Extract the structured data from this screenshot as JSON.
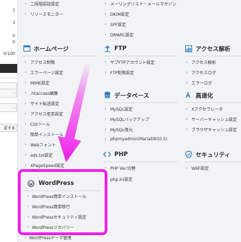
{
  "left_column": {
    "nums": [
      "1",
      "3",
      "0",
      "0",
      "0/100"
    ],
    "boxes": [
      "",
      "-",
      "-",
      "定する"
    ]
  },
  "top_items": {
    "col1": [
      "二段階認証設定",
      "リソースモニター"
    ],
    "col2": [
      "メーリングリスト・メールマガジン",
      "DKIM設定",
      "SPF設定",
      "DMARC設定"
    ]
  },
  "homepage": {
    "title": "ホームページ",
    "items": [
      "アクセス制限",
      "エラーページ設定",
      "MIME設定",
      ".htaccess編集",
      "サイト転送設定",
      "アクセス拒否設定",
      "CGIツール",
      "簡単インストール",
      "Webフォント",
      "ads.txt設定",
      "XPageSpeed設定"
    ]
  },
  "ftp": {
    "title": "FTP",
    "items": [
      "サブFTPアカウント設定",
      "FTP制限設定"
    ]
  },
  "database": {
    "title": "データベース",
    "items": [
      "MySQL設定",
      "MySQLバックアップ",
      "MySQL復元",
      "phpmyadmin(MariaDB10.5)"
    ]
  },
  "php": {
    "title": "PHP",
    "items": [
      "PHP Ver.切替",
      "php.ini設定"
    ]
  },
  "access_analysis": {
    "title": "アクセス解析",
    "items": [
      "アクセス解析",
      "アクセスログ",
      "エラーログ"
    ]
  },
  "speedup": {
    "title": "高速化",
    "items": [
      "Xアクセラレータ",
      "サーバーキャッシュ設定",
      "ブラウザキャッシュ設定"
    ]
  },
  "security": {
    "title": "セキュリティ",
    "items": [
      "WAF設定"
    ]
  },
  "wordpress": {
    "title": "WordPress",
    "items": [
      "WordPress簡単インストール",
      "WordPress簡単移行",
      "WordPressセキュリティ設定",
      "WordPressリカバリー",
      "WordPressテーマ管理"
    ]
  },
  "colors": {
    "highlight": "#ee1fe8",
    "accent": "#2a7bb8"
  }
}
